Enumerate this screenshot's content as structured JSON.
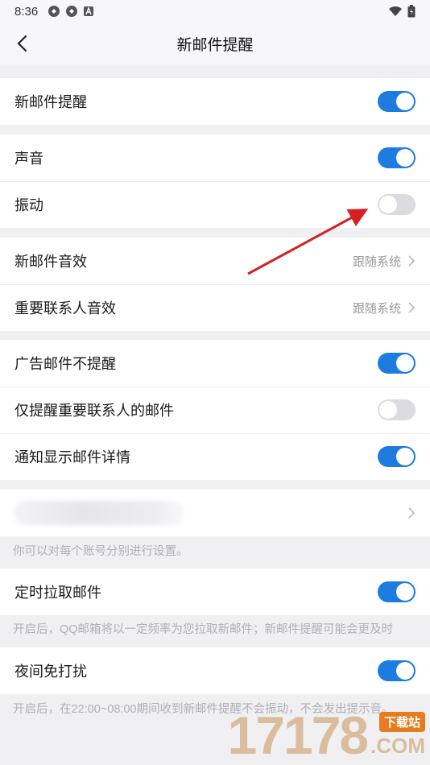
{
  "status_bar": {
    "time": "8:36"
  },
  "header": {
    "title": "新邮件提醒"
  },
  "groups": {
    "g1": {
      "new_mail_alert": {
        "label": "新邮件提醒",
        "on": true
      }
    },
    "g2": {
      "sound": {
        "label": "声音",
        "on": true
      },
      "vibrate": {
        "label": "振动",
        "on": false
      }
    },
    "g3": {
      "new_mail_sound": {
        "label": "新邮件音效",
        "value": "跟随系统"
      },
      "vip_sound": {
        "label": "重要联系人音效",
        "value": "跟随系统"
      }
    },
    "g4": {
      "ad_no_alert": {
        "label": "广告邮件不提醒",
        "on": true
      },
      "vip_only": {
        "label": "仅提醒重要联系人的邮件",
        "on": false
      },
      "show_detail": {
        "label": "通知显示邮件详情",
        "on": true
      }
    }
  },
  "account_hint": "你可以对每个账号分别进行设置。",
  "scheduled_fetch": {
    "label": "定时拉取邮件",
    "on": true
  },
  "scheduled_hint": "开启后，QQ邮箱将以一定频率为您拉取新邮件；新邮件提醒可能会更及时",
  "night_mode": {
    "label": "夜间免打扰",
    "on": true
  },
  "night_hint": "开启后，在22:00~08:00期间收到新邮件提醒不会振动，不会发出提示音。",
  "watermark": {
    "digits": "17178",
    "badge": "下载站",
    "suffix": ".COM"
  },
  "colors": {
    "accent": "#1e7be0",
    "arrow": "#d42020"
  }
}
